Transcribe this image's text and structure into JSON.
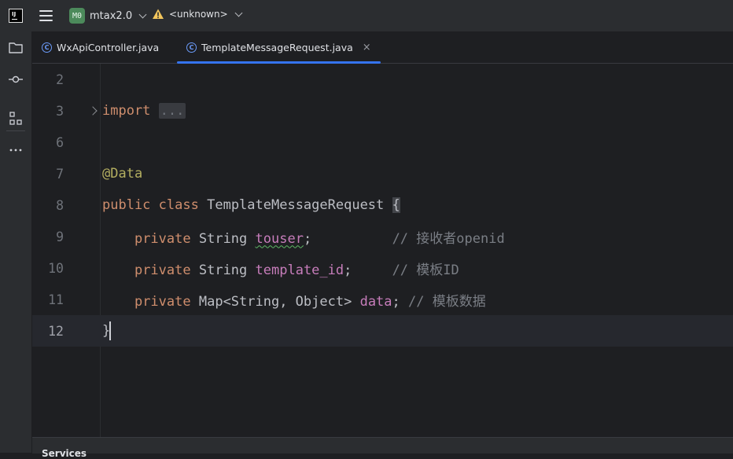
{
  "titlebar": {
    "project_badge": "M0",
    "project_name": "mtax2.0",
    "branch_name": "<unknown>"
  },
  "tabs": [
    {
      "label": "WxApiController.java",
      "icon": "class-icon",
      "active": false
    },
    {
      "label": "TemplateMessageRequest.java",
      "icon": "class-icon",
      "active": true,
      "close": "×"
    }
  ],
  "editor": {
    "lines": [
      {
        "number": "2"
      },
      {
        "number": "3",
        "kw": "import",
        "folded": "..."
      },
      {
        "number": "6"
      },
      {
        "number": "7",
        "annotation": "@Data"
      },
      {
        "number": "8",
        "kw1": "public",
        "kw2": "class",
        "name": "TemplateMessageRequest",
        "brace": "{"
      },
      {
        "number": "9",
        "kw": "private",
        "type": "String",
        "field": "touser",
        "semi": ";",
        "comment": "// 接收者openid"
      },
      {
        "number": "10",
        "kw": "private",
        "type": "String",
        "field": "template_id",
        "semi": ";",
        "comment": "// 模板ID"
      },
      {
        "number": "11",
        "kw": "private",
        "type": "Map<String, Object>",
        "field": "data",
        "semi": ";",
        "comment": "// 模板数据"
      },
      {
        "number": "12",
        "brace": "}"
      }
    ]
  },
  "bottom": {
    "label": "Services"
  },
  "colors": {
    "accent": "#3574f0",
    "keyword": "#cf8e6d",
    "annotation": "#b3ae60",
    "field": "#c77dbb",
    "comment": "#7a7e85"
  }
}
